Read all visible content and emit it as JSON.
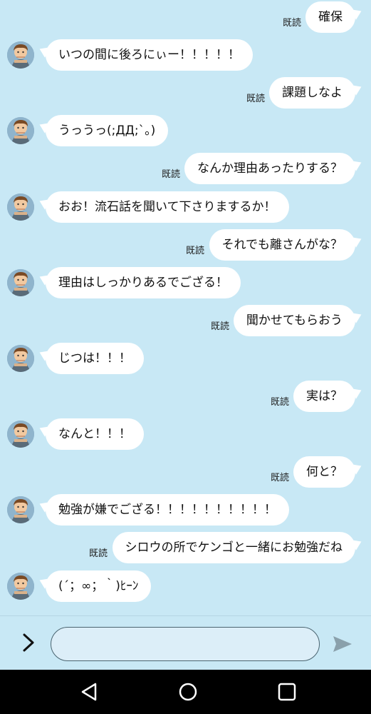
{
  "read_label": "既読",
  "messages": [
    {
      "from": "me",
      "text": "確保"
    },
    {
      "from": "them",
      "text": "いつの間に後ろにぃー！！！！！"
    },
    {
      "from": "me",
      "text": "課題しなよ"
    },
    {
      "from": "them",
      "text": "うっうっ(;ДД;`。)"
    },
    {
      "from": "me",
      "text": "なんか理由あったりする？"
    },
    {
      "from": "them",
      "text": "おお！流石話を聞いて下さりまするか！"
    },
    {
      "from": "me",
      "text": "それでも離さんがな？"
    },
    {
      "from": "them",
      "text": "理由はしっかりあるでござる！"
    },
    {
      "from": "me",
      "text": "聞かせてもらおう"
    },
    {
      "from": "them",
      "text": "じつは！！！"
    },
    {
      "from": "me",
      "text": "実は？"
    },
    {
      "from": "them",
      "text": "なんと！！！"
    },
    {
      "from": "me",
      "text": "何と？"
    },
    {
      "from": "them",
      "text": "勉強が嫌でござる！！！！！！！！！！"
    },
    {
      "from": "me",
      "text": "シロウの所でケンゴと一緒にお勉強だね"
    },
    {
      "from": "them",
      "text": "(´；∞；｀)ﾋｰﾝ"
    }
  ],
  "input": {
    "placeholder": "",
    "value": ""
  },
  "icons": {
    "chevron": "chevron-right-icon",
    "send": "send-icon",
    "back": "back-icon",
    "home": "home-icon",
    "recents": "recents-icon"
  },
  "colors": {
    "background": "#c8e8f5",
    "bubble": "#ffffff",
    "navbar": "#000000"
  }
}
